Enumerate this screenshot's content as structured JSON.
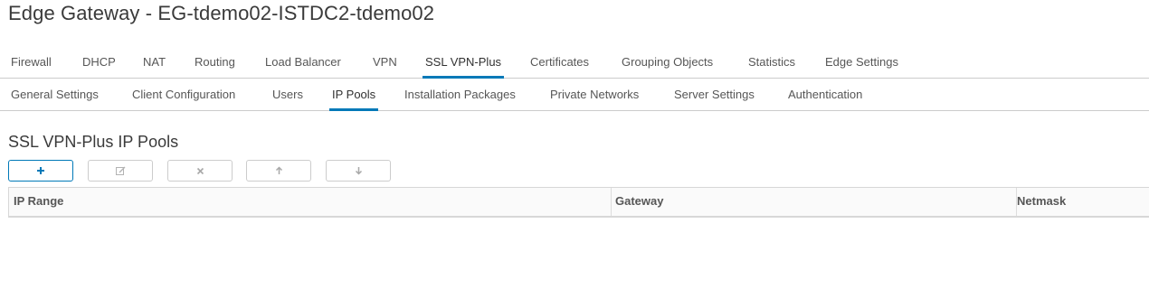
{
  "page": {
    "title": "Edge Gateway - EG-tdemo02-ISTDC2-tdemo02"
  },
  "primary_tabs": [
    {
      "label": "Firewall"
    },
    {
      "label": "DHCP"
    },
    {
      "label": "NAT"
    },
    {
      "label": "Routing"
    },
    {
      "label": "Load Balancer"
    },
    {
      "label": "VPN"
    },
    {
      "label": "SSL VPN-Plus",
      "active": true
    },
    {
      "label": "Certificates"
    },
    {
      "label": "Grouping Objects"
    },
    {
      "label": "Statistics"
    },
    {
      "label": "Edge Settings"
    }
  ],
  "secondary_tabs": [
    {
      "label": "General Settings"
    },
    {
      "label": "Client Configuration"
    },
    {
      "label": "Users"
    },
    {
      "label": "IP Pools",
      "active": true
    },
    {
      "label": "Installation Packages"
    },
    {
      "label": "Private Networks"
    },
    {
      "label": "Server Settings"
    },
    {
      "label": "Authentication"
    }
  ],
  "section": {
    "title": "SSL VPN-Plus IP Pools"
  },
  "toolbar": {
    "buttons": [
      {
        "icon": "plus-icon",
        "enabled": true
      },
      {
        "icon": "edit-icon",
        "enabled": false
      },
      {
        "icon": "close-icon",
        "enabled": false
      },
      {
        "icon": "arrow-up-icon",
        "enabled": false
      },
      {
        "icon": "arrow-down-icon",
        "enabled": false
      }
    ]
  },
  "table": {
    "columns": [
      "IP Range",
      "Gateway",
      "Netmask"
    ],
    "rows": []
  },
  "colors": {
    "accent": "#0079b8",
    "border": "#cccccc",
    "disabled_icon": "#b3b3b3"
  }
}
